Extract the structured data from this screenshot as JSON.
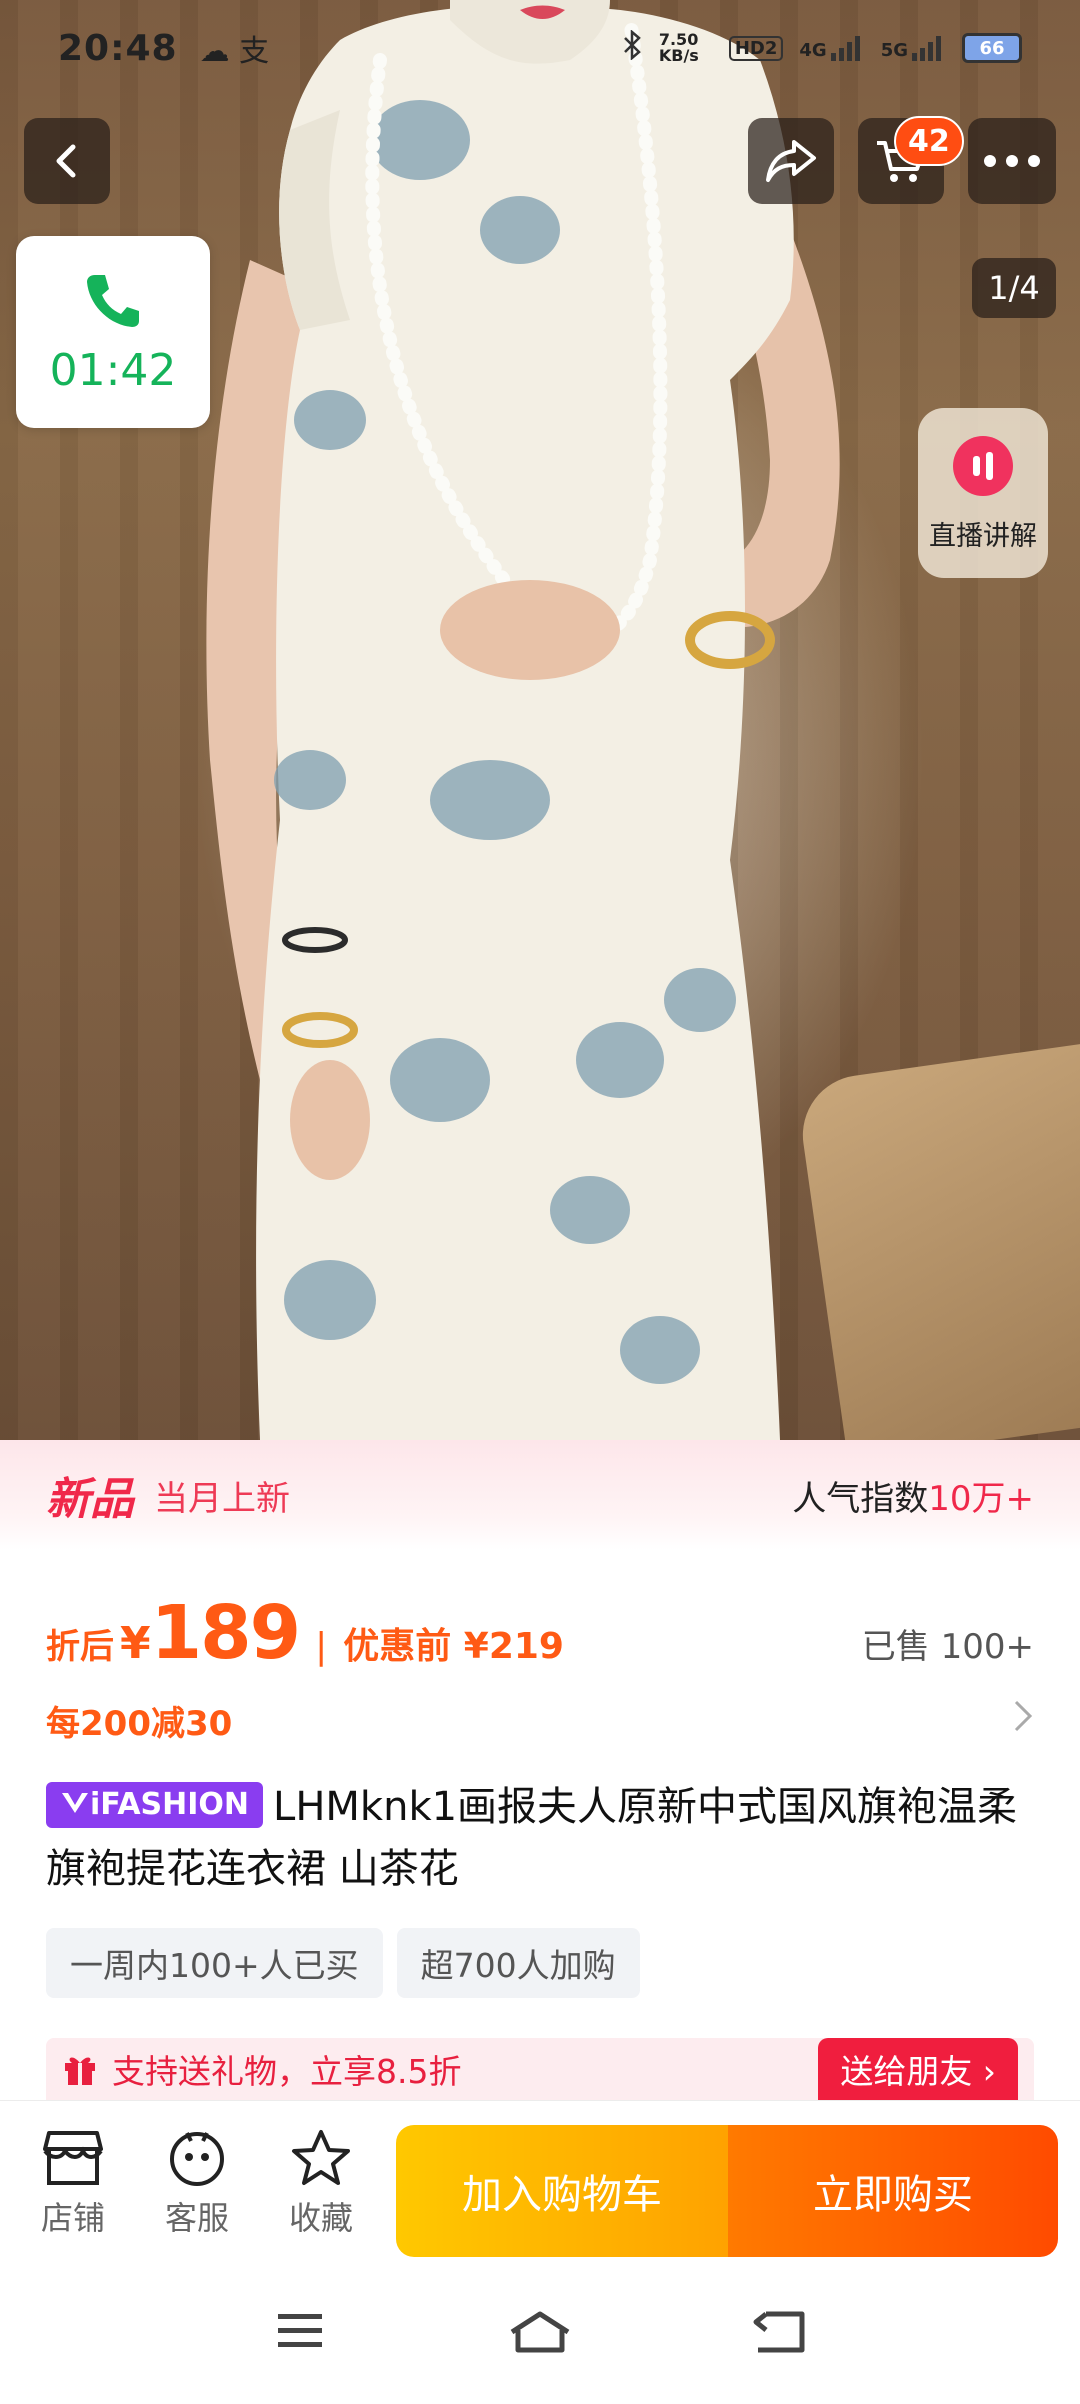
{
  "status_bar": {
    "time": "20:48",
    "notif_icons": "☁ 支",
    "net_speed": "7.50 KB/s",
    "hd": "HD2",
    "sig1": "4G",
    "sig2": "5G",
    "battery": "66"
  },
  "top": {
    "cart_count": "42",
    "image_counter": "1/4"
  },
  "call": {
    "duration": "01:42"
  },
  "live": {
    "label": "直播讲解"
  },
  "new_band": {
    "tag": "新品",
    "sub": "当月上新",
    "popularity_label": "人气指数",
    "popularity_value": "10万+"
  },
  "price": {
    "prefix": "折后",
    "currency": "¥",
    "amount": "189",
    "separator": "|",
    "original": "优惠前 ¥219",
    "sold": "已售 100+"
  },
  "promo": {
    "text": "每200减30"
  },
  "product": {
    "brand": "iFASHION",
    "title": "LHMknk1画报夫人原新中式国风旗袍温柔旗袍提花连衣裙  山茶花"
  },
  "chips": [
    "一周内100+人已买",
    "超700人加购"
  ],
  "gift": {
    "text": "支持送礼物，立享8.5折",
    "cta": "送给朋友 ›"
  },
  "actions": {
    "shop": "店铺",
    "service": "客服",
    "favorite": "收藏",
    "add_to_cart": "加入购物车",
    "buy_now": "立即购买"
  },
  "colors": {
    "accent_orange": "#ff5a14",
    "accent_red": "#f0284a",
    "call_green": "#15b35a",
    "brand_purple": "#8a3df0"
  }
}
